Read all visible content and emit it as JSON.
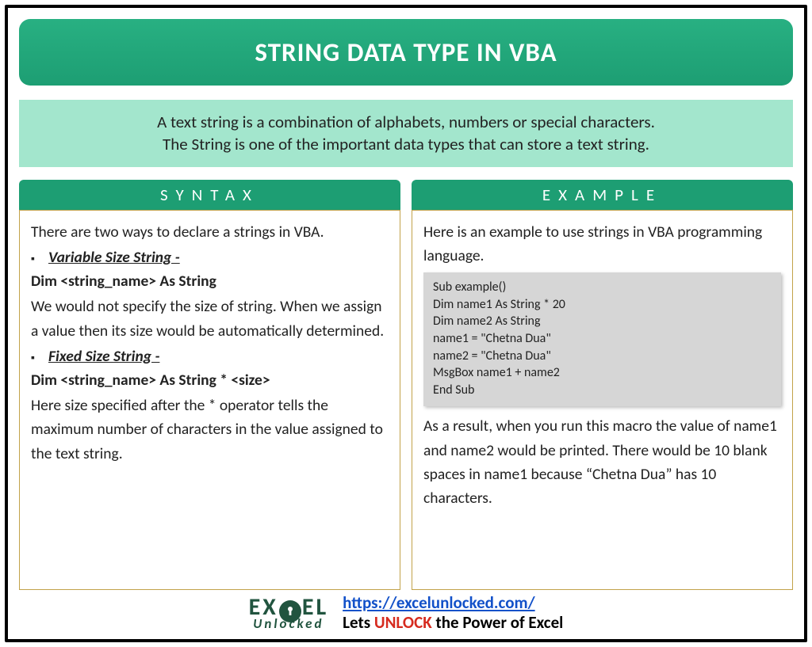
{
  "title": "STRING DATA TYPE IN VBA",
  "description_line1": "A text string is a combination of alphabets, numbers or special characters.",
  "description_line2": "The String is one of the important data types that can store a text string.",
  "syntax": {
    "header": "SYNTAX",
    "intro": "There are two ways to declare a strings in VBA.",
    "item1_title": "Variable Size String -",
    "item1_decl": "Dim <string_name> As String",
    "item1_desc": "We would not specify the size of string. When we assign a value then its size would be automatically determined.",
    "item2_title": "Fixed Size String -",
    "item2_decl": "Dim <string_name> As String * <size>",
    "item2_desc": "Here size specified after the * operator tells the maximum number of characters in the value assigned to the text string."
  },
  "example": {
    "header": "EXAMPLE",
    "intro": "Here is an example to use strings in VBA programming language.",
    "code": [
      "Sub example()",
      "Dim name1 As String * 20",
      "Dim name2 As String",
      "name1 = \"Chetna Dua\"",
      "name2 = \"Chetna Dua\"",
      "MsgBox name1 + name2",
      "End Sub"
    ],
    "result": "As a result, when you run this macro the value of name1 and name2 would be printed. There would be 10 blank spaces in name1 because “Chetna Dua” has 10 characters."
  },
  "footer": {
    "logo_top_left": "EX",
    "logo_top_right": "EL",
    "logo_bottom": "Unlocked",
    "url": "https://excelunlocked.com/",
    "tagline_pre": "Lets ",
    "tagline_unlock": "UNLOCK",
    "tagline_post": " the Power of Excel"
  }
}
